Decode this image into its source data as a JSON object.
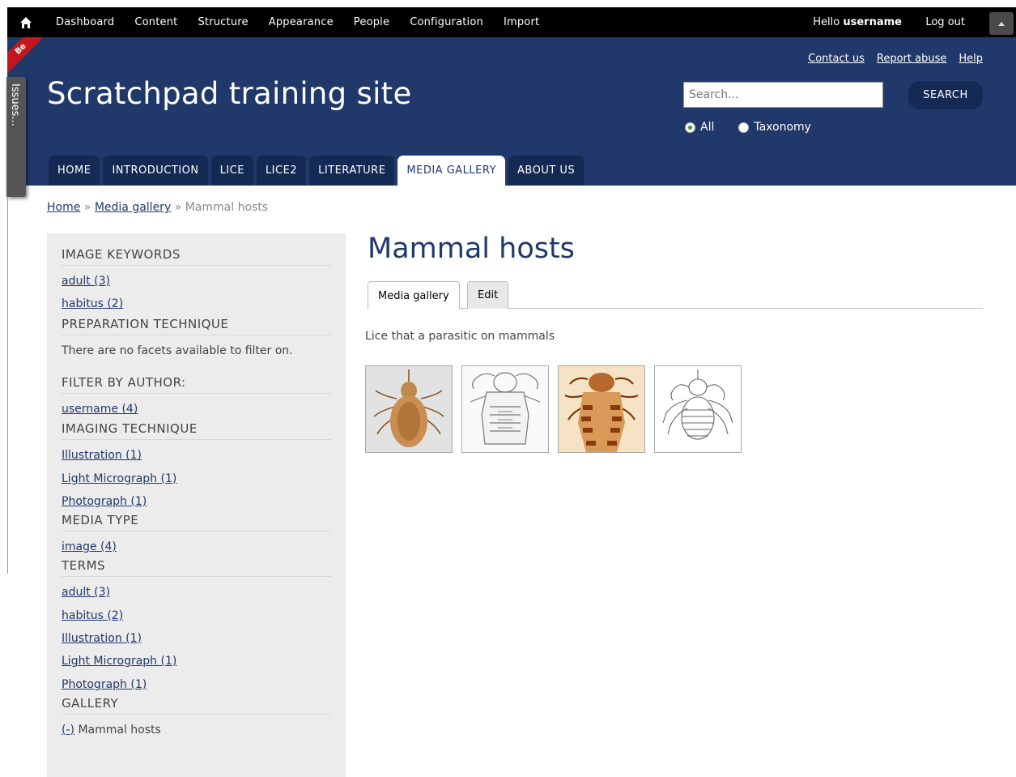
{
  "toolbar": {
    "menu": [
      "Dashboard",
      "Content",
      "Structure",
      "Appearance",
      "People",
      "Configuration",
      "Import"
    ],
    "greeting": "Hello",
    "username": "username",
    "logout": "Log out"
  },
  "ribbon": {
    "text": "Be"
  },
  "issues_tab": {
    "label": "Issues..."
  },
  "header": {
    "site_name": "Scratchpad training site",
    "links": [
      "Contact us",
      "Report abuse",
      "Help"
    ]
  },
  "search": {
    "placeholder": "Search...",
    "button": "SEARCH",
    "options": [
      {
        "label": "All",
        "selected": true
      },
      {
        "label": "Taxonomy",
        "selected": false
      }
    ]
  },
  "nav": {
    "tabs": [
      "HOME",
      "INTRODUCTION",
      "LICE",
      "LICE2",
      "LITERATURE",
      "MEDIA GALLERY",
      "ABOUT US"
    ],
    "active": "MEDIA GALLERY"
  },
  "breadcrumb": {
    "items": [
      "Home",
      "Media gallery"
    ],
    "separator": "»",
    "current": "Mammal hosts"
  },
  "sidebar": {
    "image_keywords": {
      "title": "IMAGE KEYWORDS",
      "links": [
        "adult (3)",
        "habitus (2)"
      ]
    },
    "preparation_technique": {
      "title": "PREPARATION TECHNIQUE",
      "empty": "There are no facets available to filter on."
    },
    "filter_by_author": {
      "title": "FILTER BY AUTHOR:",
      "links": [
        "username (4)"
      ]
    },
    "imaging_technique": {
      "title": "IMAGING TECHNIQUE",
      "links": [
        "Illustration (1)",
        "Light Micrograph (1)",
        "Photograph (1)"
      ]
    },
    "media_type": {
      "title": "MEDIA TYPE",
      "links": [
        "image (4)"
      ]
    },
    "terms": {
      "title": "TERMS",
      "links": [
        "adult (3)",
        "habitus (2)",
        "Illustration (1)",
        "Light Micrograph (1)",
        "Photograph (1)"
      ]
    },
    "gallery": {
      "title": "GALLERY",
      "remove": "(-)",
      "active": "Mammal hosts"
    }
  },
  "content": {
    "title": "Mammal hosts",
    "tabs": [
      "Media gallery",
      "Edit"
    ],
    "description": "Lice that a parasitic on mammals"
  },
  "colors": {
    "header_blue": "#20386a",
    "tab_dark": "#142a55",
    "sidebar_bg": "#ececec",
    "ribbon_red": "#c4161c"
  }
}
